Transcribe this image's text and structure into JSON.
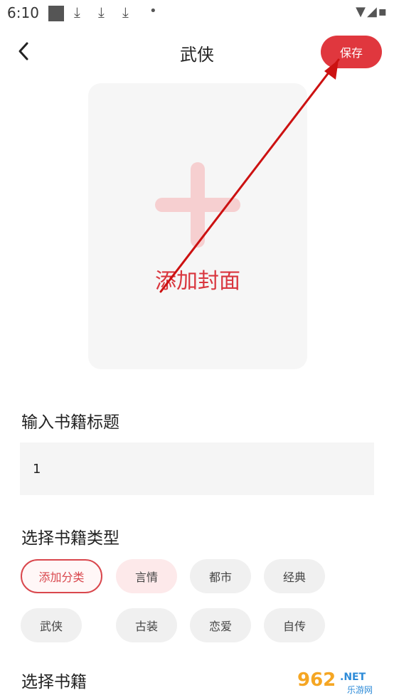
{
  "status_bar": {
    "time": "6:10",
    "download_icons": [
      "download-icon",
      "download-icon",
      "download-icon"
    ],
    "dot": "•",
    "signal_icons": "▼◢▪"
  },
  "header": {
    "back_icon": "chevron-left-icon",
    "title": "武侠",
    "save_label": "保存"
  },
  "cover": {
    "plus_icon": "plus-icon",
    "label": "添加封面"
  },
  "book_title": {
    "label": "输入书籍标题",
    "value": "1"
  },
  "category": {
    "label": "选择书籍类型",
    "add_label": "添加分类",
    "tags": [
      "言情",
      "都市",
      "经典",
      "武侠",
      "古装",
      "恋爱",
      "自传"
    ],
    "selected": "言情"
  },
  "book_select": {
    "label": "选择书籍"
  },
  "watermark": {
    "number": "962",
    "suffix": ".NET",
    "brand": "乐游网"
  },
  "colors": {
    "accent": "#e0373e",
    "selected_tag_bg": "#fde9ea",
    "annotation_arrow": "#cc1111"
  }
}
